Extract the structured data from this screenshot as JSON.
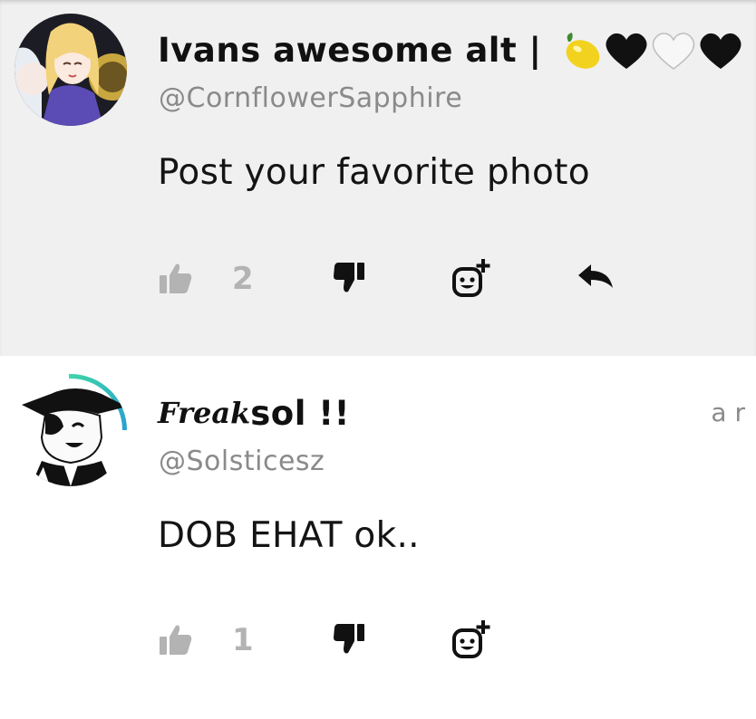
{
  "posts": [
    {
      "author_name": "Ivans awesome alt |",
      "author_emojis": [
        "lemon",
        "black-heart",
        "white-heart",
        "black-heart"
      ],
      "handle": "@CornflowerSapphire",
      "body": "Post your favorite photo",
      "like_count": "2",
      "background": "#f0f0f0"
    },
    {
      "author_name_script": "Freak",
      "author_name": "sol !!",
      "handle": "@Solsticesz",
      "timestamp": "a r",
      "body": "DOB EHAT ok..",
      "like_count": "1",
      "background": "#ffffff"
    }
  ],
  "icons": {
    "like": "thumbs-up-icon",
    "dislike": "thumbs-down-icon",
    "react": "add-reaction-icon",
    "reply": "reply-icon"
  },
  "colors": {
    "like_inactive": "#b3b3b3",
    "handle_gray": "#8a8a8a",
    "icon_black": "#111111"
  }
}
